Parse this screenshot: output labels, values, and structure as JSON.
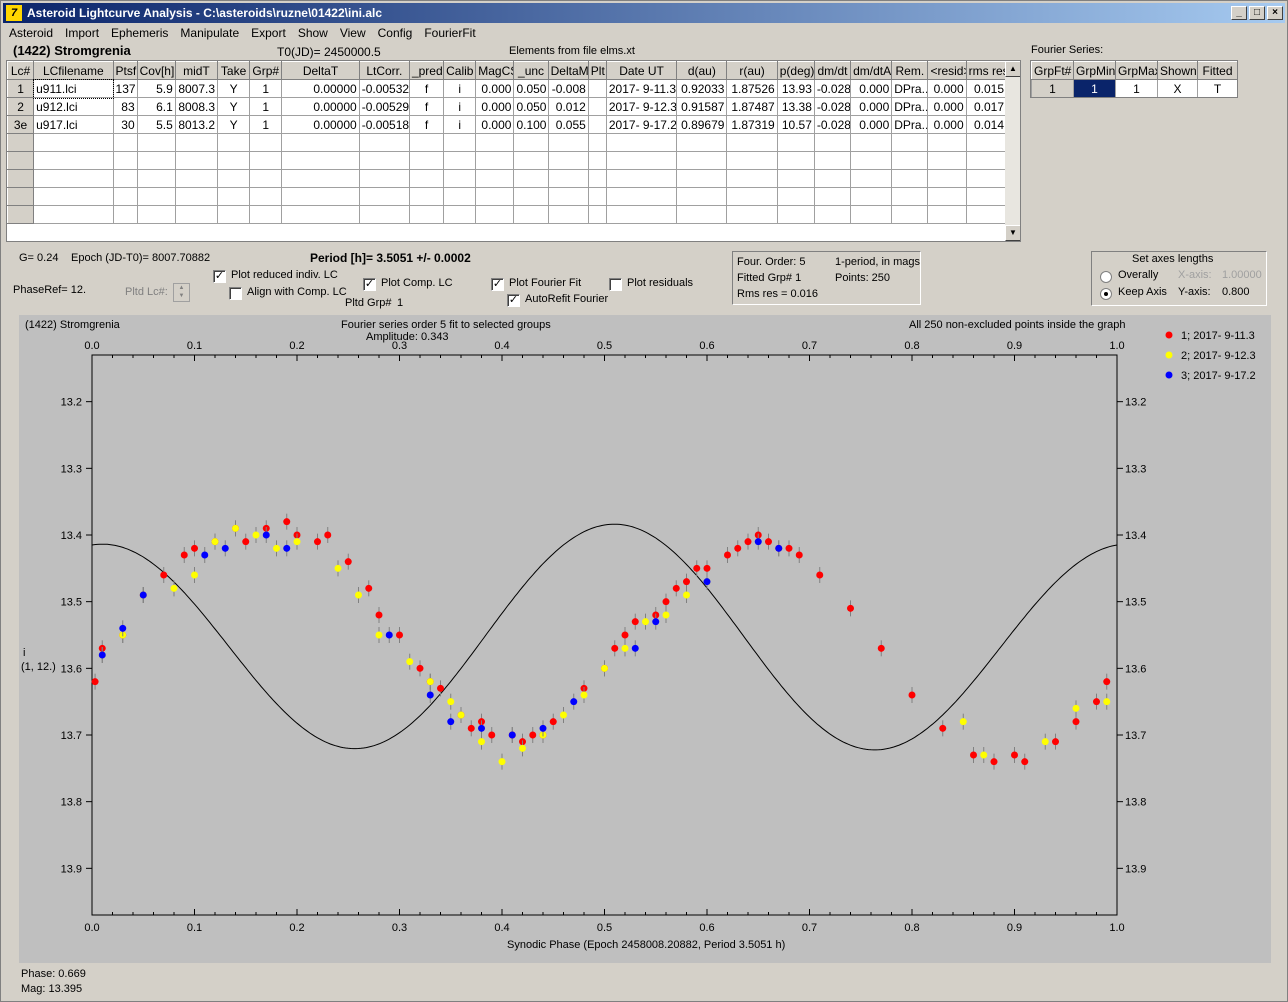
{
  "window": {
    "title": "Asteroid Lightcurve Analysis - C:\\asteroids\\ruzne\\01422\\ini.alc"
  },
  "menu": [
    "Asteroid",
    "Import",
    "Ephemeris",
    "Manipulate",
    "Export",
    "Show",
    "View",
    "Config",
    "FourierFit"
  ],
  "header": {
    "object": "(1422) Stromgrenia",
    "t0": "T0(JD)= 2450000.5",
    "elements": "Elements from file elms.xt",
    "fourier_series_label": "Fourier Series:"
  },
  "lc_table": {
    "columns": [
      "Lc#",
      "LCfilename",
      "Ptsf",
      "Cov[h]",
      "midT",
      "Take",
      "Grp#",
      "DeltaT",
      "LtCorr.",
      "_pred.",
      "Calib",
      "MagCS",
      "_unc",
      "DeltaM",
      "Plt",
      "Date UT",
      "d(au)",
      "r(au)",
      "p(deg)",
      "dm/dt",
      "dm/dtA",
      "Rem.",
      "<resid>",
      "rms res"
    ],
    "rows": [
      [
        "1",
        "u911.lci",
        "137",
        "5.9",
        "8007.3",
        "Y",
        "1",
        "0.00000",
        "-0.00532",
        "f",
        "i",
        "0.000",
        "0.050",
        "-0.008",
        "",
        "2017- 9-11.3",
        "0.92033",
        "1.87526",
        "13.93",
        "-0.028",
        "0.000",
        "DPra...",
        "0.000",
        "0.015"
      ],
      [
        "2",
        "u912.lci",
        "83",
        "6.1",
        "8008.3",
        "Y",
        "1",
        "0.00000",
        "-0.00529",
        "f",
        "i",
        "0.000",
        "0.050",
        "0.012",
        "",
        "2017- 9-12.3",
        "0.91587",
        "1.87487",
        "13.38",
        "-0.028",
        "0.000",
        "DPra...",
        "0.000",
        "0.017"
      ],
      [
        "3e",
        "u917.lci",
        "30",
        "5.5",
        "8013.2",
        "Y",
        "1",
        "0.00000",
        "-0.00518",
        "f",
        "i",
        "0.000",
        "0.100",
        "0.055",
        "",
        "2017- 9-17.2",
        "0.89679",
        "1.87319",
        "10.57",
        "-0.028",
        "0.000",
        "DPra...",
        "0.000",
        "0.014"
      ]
    ],
    "empty_rows": 5
  },
  "fourier_table": {
    "columns": [
      "GrpFt#",
      "GrpMin",
      "GrpMax",
      "Shown",
      "Fitted"
    ],
    "rows": [
      [
        "1",
        "1",
        "1",
        "X",
        "T"
      ]
    ]
  },
  "info": {
    "g": "G= 0.24",
    "epoch": "Epoch (JD-T0)= 8007.70882",
    "period": "Period [h]= 3.5051 +/- 0.0002",
    "phaseref": "PhaseRef= 12.",
    "pltd_lc": "Pltd Lc#:",
    "pltd_grp": "Pltd Grp#",
    "pltd_grp_val": "1"
  },
  "checks": {
    "plot_reduced": {
      "label": "Plot reduced indiv. LC",
      "checked": true
    },
    "align_comp": {
      "label": "Align with Comp. LC",
      "checked": false
    },
    "plot_comp": {
      "label": "Plot Comp. LC",
      "checked": true
    },
    "plot_fourier": {
      "label": "Plot Fourier Fit",
      "checked": true
    },
    "autorefit": {
      "label": "AutoRefit Fourier",
      "checked": true
    },
    "plot_residuals": {
      "label": "Plot residuals",
      "checked": false
    }
  },
  "fit_info": {
    "order": "Four. Order:  5",
    "mode": "1-period, in mags",
    "fitted": "Fitted Grp# 1",
    "points": "Points: 250",
    "rms": "Rms res    = 0.016"
  },
  "axes_box": {
    "title": "Set axes lengths",
    "overall": "Overally",
    "keep": "Keep Axis",
    "selected": "keep",
    "xaxis_label": "X-axis:",
    "xaxis_val": "1.00000",
    "yaxis_label": "Y-axis:",
    "yaxis_val": "0.800"
  },
  "plot": {
    "object": "(1422) Stromgrenia",
    "title": "Fourier series order 5 fit to selected groups",
    "amplitude": "Amplitude: 0.343",
    "note": "All 250 non-excluded points inside the graph",
    "ylabel": "i",
    "ylabel2": "(1, 12.)",
    "xlabel": "Synodic Phase (Epoch 2458008.20882, Period 3.5051 h)"
  },
  "status": {
    "phase": "Phase:  0.669",
    "mag": "Mag:    13.395"
  },
  "chart_data": {
    "type": "scatter",
    "xlim": [
      0,
      1
    ],
    "ylim": [
      13.13,
      13.97
    ],
    "y_inverted": true,
    "xticks": [
      "0.0",
      "0.1",
      "0.2",
      "0.3",
      "0.4",
      "0.5",
      "0.6",
      "0.7",
      "0.8",
      "0.9",
      "1.0"
    ],
    "yticks": [
      "13.2",
      "13.3",
      "13.4",
      "13.5",
      "13.6",
      "13.7",
      "13.8",
      "13.9"
    ],
    "series": [
      {
        "name": "1; 2017- 9-11.3",
        "color": "#ff0000",
        "x": [
          0.003,
          0.01,
          0.03,
          0.05,
          0.07,
          0.09,
          0.1,
          0.12,
          0.14,
          0.15,
          0.17,
          0.19,
          0.2,
          0.22,
          0.23,
          0.25,
          0.27,
          0.28,
          0.3,
          0.32,
          0.33,
          0.34,
          0.36,
          0.37,
          0.38,
          0.39,
          0.41,
          0.42,
          0.43,
          0.44,
          0.45,
          0.48,
          0.5,
          0.51,
          0.52,
          0.53,
          0.55,
          0.56,
          0.57,
          0.58,
          0.59,
          0.6,
          0.62,
          0.63,
          0.64,
          0.65,
          0.66,
          0.67,
          0.68,
          0.69,
          0.71,
          0.74,
          0.77,
          0.8,
          0.83,
          0.86,
          0.88,
          0.9,
          0.91,
          0.94,
          0.96,
          0.98,
          0.99
        ],
        "y": [
          13.62,
          13.57,
          13.55,
          13.49,
          13.46,
          13.43,
          13.42,
          13.41,
          13.39,
          13.41,
          13.39,
          13.38,
          13.4,
          13.41,
          13.4,
          13.44,
          13.48,
          13.52,
          13.55,
          13.6,
          13.62,
          13.63,
          13.67,
          13.69,
          13.68,
          13.7,
          13.7,
          13.71,
          13.7,
          13.7,
          13.68,
          13.63,
          13.6,
          13.57,
          13.55,
          13.53,
          13.52,
          13.5,
          13.48,
          13.47,
          13.45,
          13.45,
          13.43,
          13.42,
          13.41,
          13.4,
          13.41,
          13.42,
          13.42,
          13.43,
          13.46,
          13.51,
          13.57,
          13.64,
          13.69,
          13.73,
          13.74,
          13.73,
          13.74,
          13.71,
          13.68,
          13.65,
          13.62
        ]
      },
      {
        "name": "2; 2017- 9-12.3",
        "color": "#ffff00",
        "x": [
          0.01,
          0.03,
          0.05,
          0.08,
          0.1,
          0.12,
          0.14,
          0.16,
          0.18,
          0.2,
          0.24,
          0.26,
          0.28,
          0.31,
          0.33,
          0.35,
          0.36,
          0.38,
          0.4,
          0.42,
          0.44,
          0.46,
          0.48,
          0.5,
          0.52,
          0.54,
          0.56,
          0.58,
          0.6,
          0.85,
          0.87,
          0.93,
          0.96,
          0.99
        ],
        "y": [
          13.58,
          13.55,
          13.49,
          13.48,
          13.46,
          13.41,
          13.39,
          13.4,
          13.42,
          13.41,
          13.45,
          13.49,
          13.55,
          13.59,
          13.62,
          13.65,
          13.67,
          13.71,
          13.74,
          13.72,
          13.7,
          13.67,
          13.64,
          13.6,
          13.57,
          13.53,
          13.52,
          13.49,
          13.47,
          13.68,
          13.73,
          13.71,
          13.66,
          13.65
        ]
      },
      {
        "name": "3; 2017- 9-17.2",
        "color": "#0000ff",
        "x": [
          0.01,
          0.03,
          0.05,
          0.11,
          0.13,
          0.17,
          0.19,
          0.29,
          0.33,
          0.35,
          0.38,
          0.41,
          0.44,
          0.47,
          0.53,
          0.55,
          0.6,
          0.65,
          0.67
        ],
        "y": [
          13.58,
          13.54,
          13.49,
          13.43,
          13.42,
          13.4,
          13.42,
          13.55,
          13.64,
          13.68,
          13.69,
          13.7,
          13.69,
          13.65,
          13.57,
          13.53,
          13.47,
          13.41,
          13.42
        ]
      }
    ],
    "fit": {
      "name": "Fourier fit",
      "mean": 13.56,
      "terms": [
        [
          0.015,
          0.0
        ],
        [
          -0.16,
          -0.02
        ]
      ]
    },
    "legend_position": "top-right"
  }
}
